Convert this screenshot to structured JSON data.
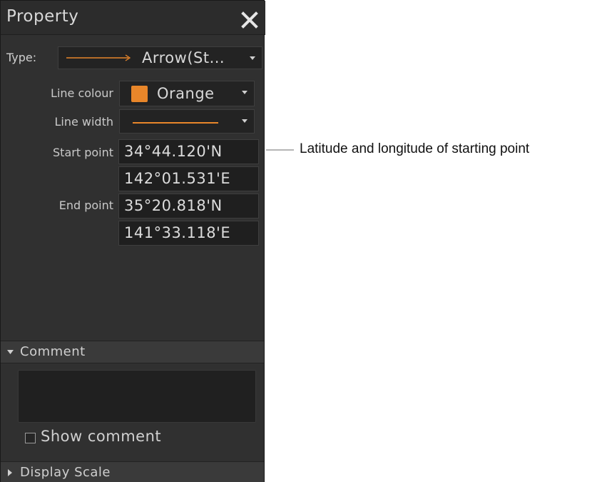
{
  "panel": {
    "title": "Property",
    "close_icon": "close-icon"
  },
  "type": {
    "label": "Type:",
    "value": "Arrow(St...",
    "line_color": "#e8862a"
  },
  "line_colour": {
    "label": "Line colour",
    "value": "Orange",
    "swatch_color": "#e8862a"
  },
  "line_width": {
    "label": "Line width"
  },
  "start_point": {
    "label": "Start point",
    "latitude": "34°44.120'N",
    "longitude": "142°01.531'E"
  },
  "end_point": {
    "label": "End point",
    "latitude": "35°20.818'N",
    "longitude": "141°33.118'E"
  },
  "comment_section": {
    "label": "Comment",
    "show_comment_label": "Show comment",
    "show_comment_checked": false
  },
  "display_scale_section": {
    "label": "Display Scale"
  },
  "annotation": {
    "text": "Latitude and longitude of starting point"
  },
  "colors": {
    "panel_bg": "#303030",
    "accent_orange": "#e8862a"
  }
}
